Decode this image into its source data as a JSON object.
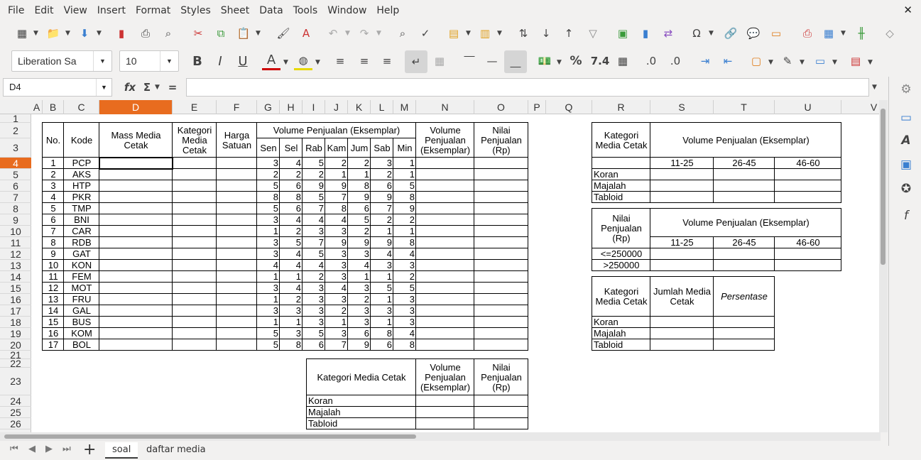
{
  "menu": [
    "File",
    "Edit",
    "View",
    "Insert",
    "Format",
    "Styles",
    "Sheet",
    "Data",
    "Tools",
    "Window",
    "Help"
  ],
  "font_name": "Liberation Sa",
  "font_size": "10",
  "name_box": "D4",
  "columns": [
    {
      "l": "A",
      "w": 16
    },
    {
      "l": "B",
      "w": 30
    },
    {
      "l": "C",
      "w": 50
    },
    {
      "l": "D",
      "w": 103
    },
    {
      "l": "E",
      "w": 62
    },
    {
      "l": "F",
      "w": 57
    },
    {
      "l": "G",
      "w": 32
    },
    {
      "l": "H",
      "w": 32
    },
    {
      "l": "I",
      "w": 32
    },
    {
      "l": "J",
      "w": 32
    },
    {
      "l": "K",
      "w": 32
    },
    {
      "l": "L",
      "w": 32
    },
    {
      "l": "M",
      "w": 32
    },
    {
      "l": "N",
      "w": 82
    },
    {
      "l": "O",
      "w": 76
    },
    {
      "l": "P",
      "w": 25
    },
    {
      "l": "Q",
      "w": 65
    },
    {
      "l": "R",
      "w": 82
    },
    {
      "l": "S",
      "w": 89
    },
    {
      "l": "T",
      "w": 86
    },
    {
      "l": "U",
      "w": 94
    },
    {
      "l": "V",
      "w": 92
    }
  ],
  "rows": [
    {
      "n": "1",
      "h": 12
    },
    {
      "n": "2",
      "h": 22
    },
    {
      "n": "3",
      "h": 27
    },
    {
      "n": "4",
      "h": 16
    },
    {
      "n": "5",
      "h": 16
    },
    {
      "n": "6",
      "h": 16
    },
    {
      "n": "7",
      "h": 16
    },
    {
      "n": "8",
      "h": 16
    },
    {
      "n": "9",
      "h": 16
    },
    {
      "n": "10",
      "h": 16
    },
    {
      "n": "11",
      "h": 16
    },
    {
      "n": "12",
      "h": 16
    },
    {
      "n": "13",
      "h": 16
    },
    {
      "n": "14",
      "h": 16
    },
    {
      "n": "15",
      "h": 16
    },
    {
      "n": "16",
      "h": 16
    },
    {
      "n": "17",
      "h": 16
    },
    {
      "n": "18",
      "h": 16
    },
    {
      "n": "19",
      "h": 16
    },
    {
      "n": "20",
      "h": 16
    },
    {
      "n": "21",
      "h": 12
    },
    {
      "n": "22",
      "h": 12
    },
    {
      "n": "23",
      "h": 39
    },
    {
      "n": "24",
      "h": 16
    },
    {
      "n": "25",
      "h": 16
    },
    {
      "n": "26",
      "h": 16
    }
  ],
  "main_table": {
    "h_no": "No.",
    "h_kode": "Kode",
    "h_mass": "Mass Media Cetak",
    "h_kategori": "Kategori Media Cetak",
    "h_harga": "Harga Satuan",
    "h_volume": "Volume Penjualan (Eksemplar)",
    "h_volume2": "Volume Penjualan (Eksemplar)",
    "h_nilai": "Nilai Penjualan (Rp)",
    "days": [
      "Sen",
      "Sel",
      "Rab",
      "Kam",
      "Jum",
      "Sab",
      "Min"
    ],
    "rows": [
      {
        "no": "1",
        "kode": "PCP",
        "v": [
          "3",
          "4",
          "5",
          "2",
          "2",
          "3",
          "1"
        ]
      },
      {
        "no": "2",
        "kode": "AKS",
        "v": [
          "2",
          "2",
          "2",
          "1",
          "1",
          "2",
          "1"
        ]
      },
      {
        "no": "3",
        "kode": "HTP",
        "v": [
          "5",
          "6",
          "9",
          "9",
          "8",
          "6",
          "5"
        ]
      },
      {
        "no": "4",
        "kode": "PKR",
        "v": [
          "8",
          "8",
          "5",
          "7",
          "9",
          "9",
          "8"
        ]
      },
      {
        "no": "5",
        "kode": "TMP",
        "v": [
          "5",
          "6",
          "7",
          "8",
          "6",
          "7",
          "9"
        ]
      },
      {
        "no": "6",
        "kode": "BNI",
        "v": [
          "3",
          "4",
          "4",
          "4",
          "5",
          "2",
          "2"
        ]
      },
      {
        "no": "7",
        "kode": "CAR",
        "v": [
          "1",
          "2",
          "3",
          "3",
          "2",
          "1",
          "1"
        ]
      },
      {
        "no": "8",
        "kode": "RDB",
        "v": [
          "3",
          "5",
          "7",
          "9",
          "9",
          "9",
          "8"
        ]
      },
      {
        "no": "9",
        "kode": "GAT",
        "v": [
          "3",
          "4",
          "5",
          "3",
          "3",
          "4",
          "4"
        ]
      },
      {
        "no": "10",
        "kode": "KON",
        "v": [
          "4",
          "4",
          "4",
          "3",
          "4",
          "3",
          "3"
        ]
      },
      {
        "no": "11",
        "kode": "FEM",
        "v": [
          "1",
          "1",
          "2",
          "3",
          "1",
          "1",
          "2"
        ]
      },
      {
        "no": "12",
        "kode": "MOT",
        "v": [
          "3",
          "4",
          "3",
          "4",
          "3",
          "5",
          "5"
        ]
      },
      {
        "no": "13",
        "kode": "FRU",
        "v": [
          "1",
          "2",
          "3",
          "3",
          "2",
          "1",
          "3"
        ]
      },
      {
        "no": "14",
        "kode": "GAL",
        "v": [
          "3",
          "3",
          "3",
          "2",
          "3",
          "3",
          "3"
        ]
      },
      {
        "no": "15",
        "kode": "BUS",
        "v": [
          "1",
          "1",
          "3",
          "1",
          "3",
          "1",
          "3"
        ]
      },
      {
        "no": "16",
        "kode": "KOM",
        "v": [
          "5",
          "3",
          "5",
          "3",
          "6",
          "8",
          "4"
        ]
      },
      {
        "no": "17",
        "kode": "BOL",
        "v": [
          "5",
          "8",
          "6",
          "7",
          "9",
          "6",
          "8"
        ]
      }
    ]
  },
  "bottom_table": {
    "h1": "Kategori Media Cetak",
    "h2": "Volume Penjualan (Eksemplar)",
    "h3": "Nilai Penjualan (Rp)",
    "rows": [
      "Koran",
      "Majalah",
      "Tabloid"
    ]
  },
  "right_table1": {
    "h1": "Kategori Media Cetak",
    "h2": "Volume Penjualan (Eksemplar)",
    "ranges": [
      "11-25",
      "26-45",
      "46-60"
    ],
    "rows": [
      "Koran",
      "Majalah",
      "Tabloid"
    ]
  },
  "right_table2": {
    "h1": "Nilai Penjualan (Rp)",
    "h2": "Volume Penjualan (Eksemplar)",
    "ranges": [
      "11-25",
      "26-45",
      "46-60"
    ],
    "rows": [
      "<=250000",
      ">250000"
    ]
  },
  "right_table3": {
    "h1": "Kategori Media Cetak",
    "h2": "Jumlah Media Cetak",
    "h3": "Persentase",
    "rows": [
      "Koran",
      "Majalah",
      "Tabloid"
    ]
  },
  "tabs": [
    "soal",
    "daftar media"
  ],
  "accent": "#e86c1f"
}
